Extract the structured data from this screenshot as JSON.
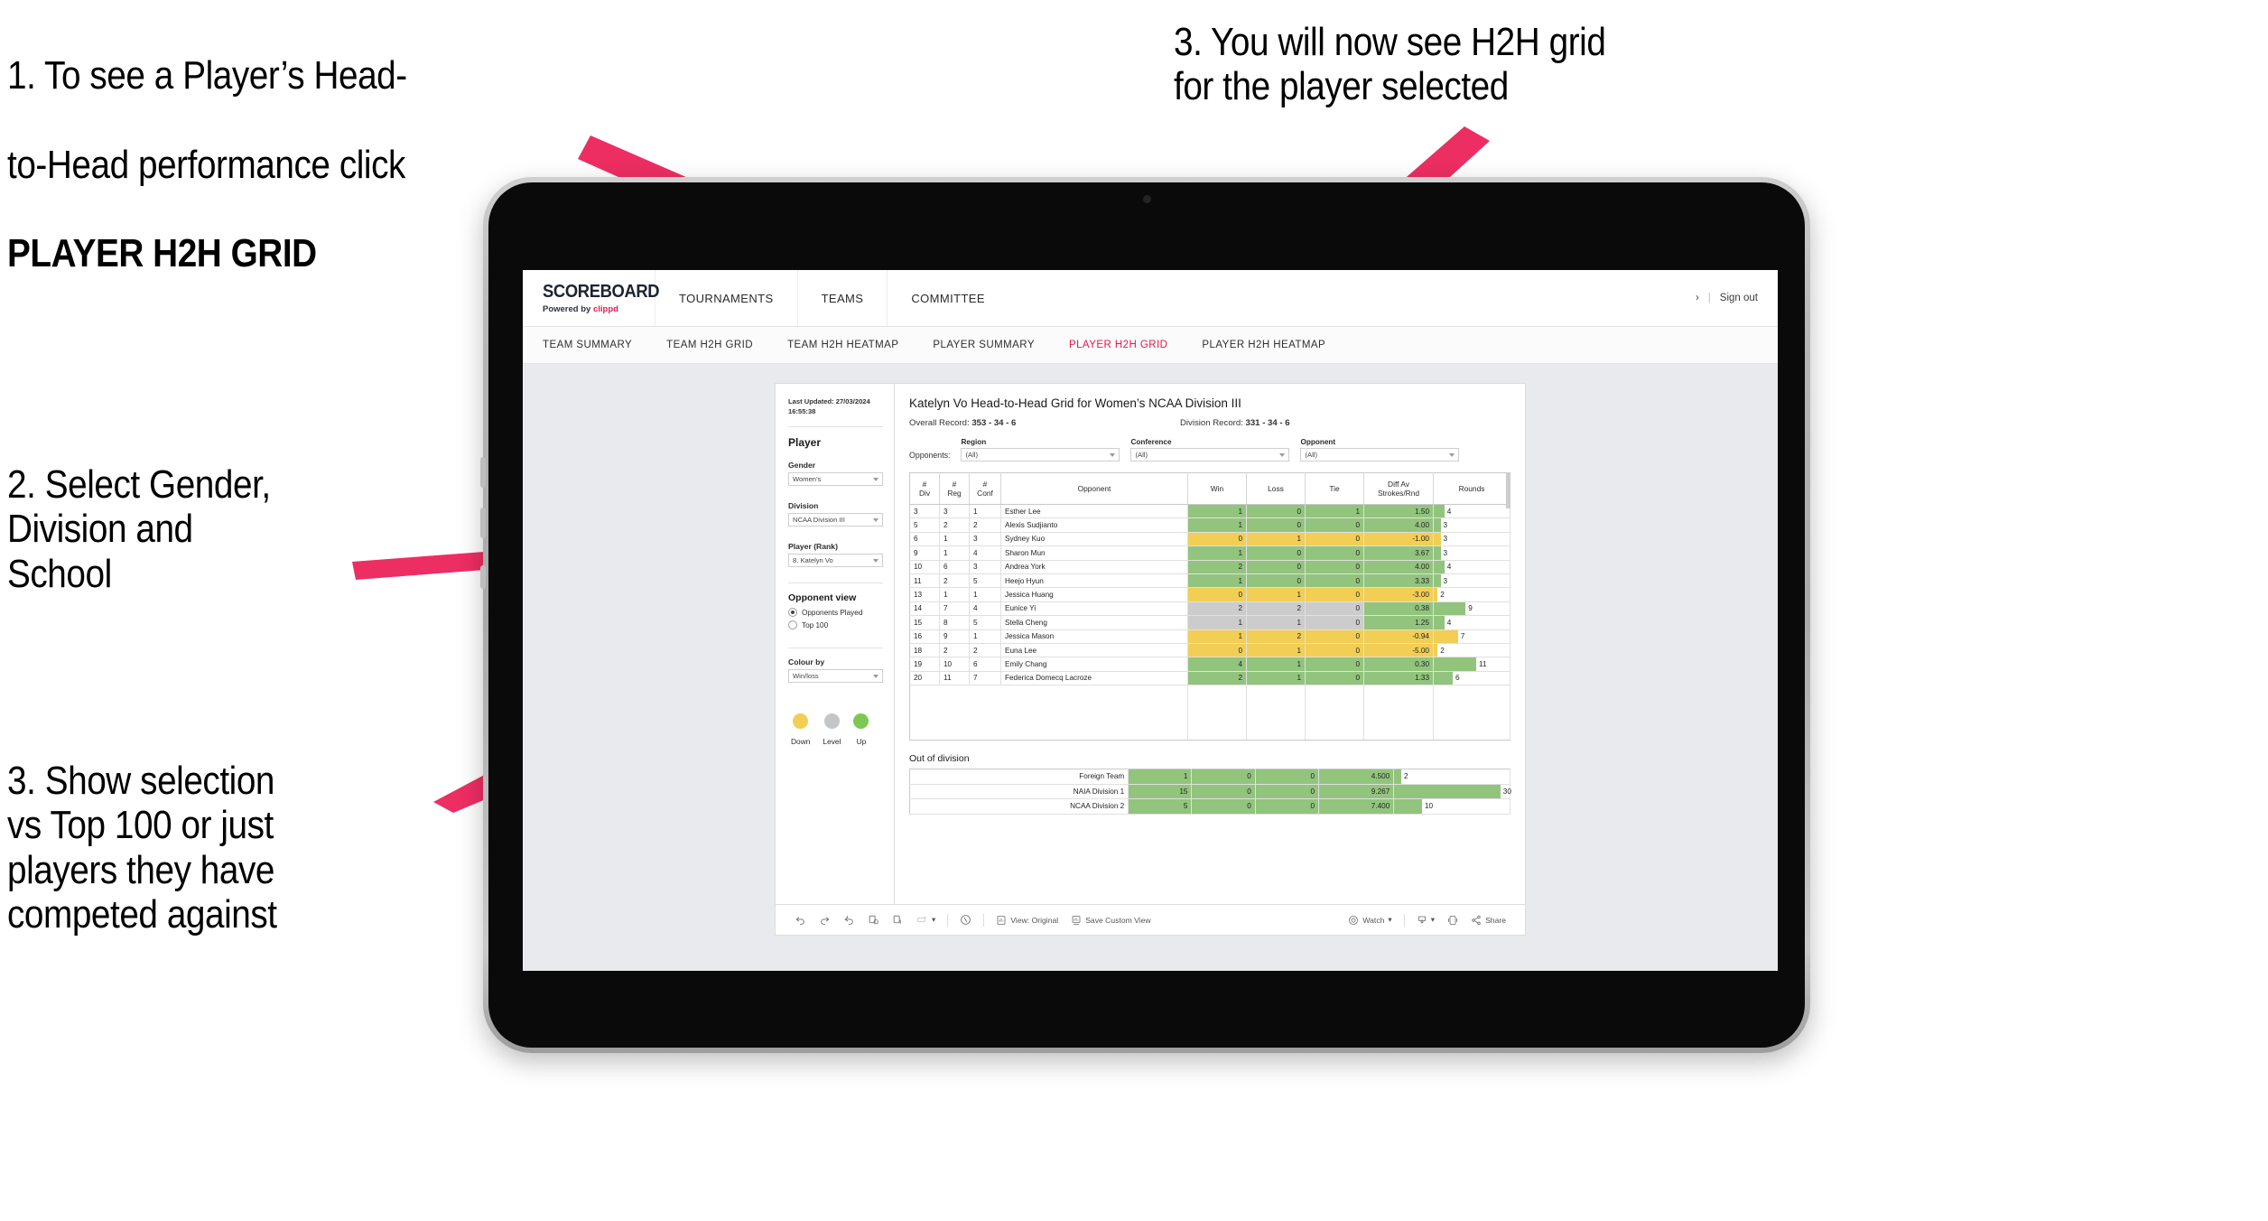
{
  "annotations": {
    "c1_line1": "1. To see a Player’s Head-",
    "c1_line2": "to-Head performance click",
    "c1_bold": "PLAYER H2H GRID",
    "c2": "2. Select Gender,\nDivision and\nSchool",
    "c3": "3. Show selection\nvs Top 100 or just\nplayers they have\ncompeted against",
    "c4": "3. You will now see H2H grid\nfor the player selected"
  },
  "colors": {
    "accent_pink": "#ED2E63",
    "brand_red": "#E8174C",
    "win_green": "#92C47D",
    "loss_yellow": "#F2CE55",
    "level_grey": "#CCCCCC",
    "canvas_grey": "#E8EAED"
  },
  "topbar": {
    "logo_word": "SCOREBOARD",
    "logo_sub_prefix": "Powered by ",
    "logo_sub_brand": "clippd",
    "items": [
      {
        "label": "TOURNAMENTS"
      },
      {
        "label": "TEAMS"
      },
      {
        "label": "COMMITTEE"
      }
    ],
    "chevron": "›",
    "separator": "|",
    "sign_out": "Sign out"
  },
  "subnav": {
    "items": [
      {
        "label": "TEAM SUMMARY",
        "active": false
      },
      {
        "label": "TEAM H2H GRID",
        "active": false
      },
      {
        "label": "TEAM H2H HEATMAP",
        "active": false
      },
      {
        "label": "PLAYER SUMMARY",
        "active": false
      },
      {
        "label": "PLAYER H2H GRID",
        "active": true
      },
      {
        "label": "PLAYER H2H HEATMAP",
        "active": false
      }
    ]
  },
  "controls": {
    "last_updated": "Last Updated: 27/03/2024\n16:55:38",
    "player_heading": "Player",
    "gender": {
      "label": "Gender",
      "value": "Women’s"
    },
    "division": {
      "label": "Division",
      "value": "NCAA Division III"
    },
    "player_rank": {
      "label": "Player (Rank)",
      "value": "8. Katelyn Vo"
    },
    "opponent_view": {
      "heading": "Opponent view",
      "options": [
        {
          "label": "Opponents Played",
          "selected": true
        },
        {
          "label": "Top 100",
          "selected": false
        }
      ]
    },
    "colour_by": {
      "label": "Colour by",
      "value": "Win/loss"
    },
    "legend": [
      {
        "label": "Down",
        "color": "#F2CE55"
      },
      {
        "label": "Level",
        "color": "#C3C6C9"
      },
      {
        "label": "Up",
        "color": "#7DC855"
      }
    ]
  },
  "main": {
    "title": "Katelyn Vo Head-to-Head Grid for Women’s NCAA Division III",
    "overall_record_label": "Overall Record: ",
    "overall_record_value": "353 -  34 - 6",
    "division_record_label": "Division Record: ",
    "division_record_value": "331 -  34 - 6",
    "opponents_label": "Opponents:",
    "filters": [
      {
        "label": "Region",
        "value": "(All)"
      },
      {
        "label": "Conference",
        "value": "(All)"
      },
      {
        "label": "Opponent",
        "value": "(All)"
      }
    ],
    "grid": {
      "headers": [
        {
          "l1": "#",
          "l2": "Div"
        },
        {
          "l1": "#",
          "l2": "Reg"
        },
        {
          "l1": "#",
          "l2": "Conf"
        },
        {
          "l1": "Opponent",
          "l2": ""
        },
        {
          "l1": "Win",
          "l2": ""
        },
        {
          "l1": "Loss",
          "l2": ""
        },
        {
          "l1": "Tie",
          "l2": ""
        },
        {
          "l1": "Diff Av",
          "l2": "Strokes/Rnd"
        },
        {
          "l1": "Rounds",
          "l2": ""
        }
      ],
      "rows": [
        {
          "div": "3",
          "reg": "3",
          "conf": "1",
          "opponent": "Esther Lee",
          "win": "1",
          "loss": "0",
          "tie": "1",
          "diff": "1.50",
          "rounds": "4",
          "color": "#92C47D",
          "rounds_pct": 14
        },
        {
          "div": "5",
          "reg": "2",
          "conf": "2",
          "opponent": "Alexis Sudjianto",
          "win": "1",
          "loss": "0",
          "tie": "0",
          "diff": "4.00",
          "rounds": "3",
          "color": "#92C47D",
          "rounds_pct": 9
        },
        {
          "div": "6",
          "reg": "1",
          "conf": "3",
          "opponent": "Sydney Kuo",
          "win": "0",
          "loss": "1",
          "tie": "0",
          "diff": "-1.00",
          "rounds": "3",
          "color": "#F2CE55",
          "rounds_pct": 9
        },
        {
          "div": "9",
          "reg": "1",
          "conf": "4",
          "opponent": "Sharon Mun",
          "win": "1",
          "loss": "0",
          "tie": "0",
          "diff": "3.67",
          "rounds": "3",
          "color": "#92C47D",
          "rounds_pct": 9
        },
        {
          "div": "10",
          "reg": "6",
          "conf": "3",
          "opponent": "Andrea York",
          "win": "2",
          "loss": "0",
          "tie": "0",
          "diff": "4.00",
          "rounds": "4",
          "color": "#92C47D",
          "rounds_pct": 14
        },
        {
          "div": "11",
          "reg": "2",
          "conf": "5",
          "opponent": "Heejo Hyun",
          "win": "1",
          "loss": "0",
          "tie": "0",
          "diff": "3.33",
          "rounds": "3",
          "color": "#92C47D",
          "rounds_pct": 9
        },
        {
          "div": "13",
          "reg": "1",
          "conf": "1",
          "opponent": "Jessica Huang",
          "win": "0",
          "loss": "1",
          "tie": "0",
          "diff": "-3.00",
          "rounds": "2",
          "color": "#F2CE55",
          "rounds_pct": 5
        },
        {
          "div": "14",
          "reg": "7",
          "conf": "4",
          "opponent": "Eunice Yi",
          "win": "2",
          "loss": "2",
          "tie": "0",
          "diff": "0.38",
          "rounds": "9",
          "color": "#CCCCCC",
          "diff_color": "#92C47D",
          "rounds_pct": 42
        },
        {
          "div": "15",
          "reg": "8",
          "conf": "5",
          "opponent": "Stella Cheng",
          "win": "1",
          "loss": "1",
          "tie": "0",
          "diff": "1.25",
          "rounds": "4",
          "color": "#CCCCCC",
          "diff_color": "#92C47D",
          "rounds_pct": 14
        },
        {
          "div": "16",
          "reg": "9",
          "conf": "1",
          "opponent": "Jessica Mason",
          "win": "1",
          "loss": "2",
          "tie": "0",
          "diff": "-0.94",
          "rounds": "7",
          "color": "#F2CE55",
          "rounds_pct": 32
        },
        {
          "div": "18",
          "reg": "2",
          "conf": "2",
          "opponent": "Euna Lee",
          "win": "0",
          "loss": "1",
          "tie": "0",
          "diff": "-5.00",
          "rounds": "2",
          "color": "#F2CE55",
          "rounds_pct": 5
        },
        {
          "div": "19",
          "reg": "10",
          "conf": "6",
          "opponent": "Emily Chang",
          "win": "4",
          "loss": "1",
          "tie": "0",
          "diff": "0.30",
          "rounds": "11",
          "color": "#92C47D",
          "rounds_pct": 56
        },
        {
          "div": "20",
          "reg": "11",
          "conf": "7",
          "opponent": "Federica Domecq Lacroze",
          "win": "2",
          "loss": "1",
          "tie": "0",
          "diff": "1.33",
          "rounds": "6",
          "color": "#92C47D",
          "rounds_pct": 25
        }
      ]
    },
    "out_of_division": {
      "title": "Out of division",
      "rows": [
        {
          "label": "Foreign Team",
          "win": "1",
          "loss": "0",
          "tie": "0",
          "diff": "4.500",
          "rounds": "2",
          "color": "#92C47D",
          "rounds_pct": 6
        },
        {
          "label": "NAIA Division 1",
          "win": "15",
          "loss": "0",
          "tie": "0",
          "diff": "9.267",
          "rounds": "30",
          "color": "#92C47D",
          "rounds_pct": 92
        },
        {
          "label": "NCAA Division 2",
          "win": "5",
          "loss": "0",
          "tie": "0",
          "diff": "7.400",
          "rounds": "10",
          "color": "#92C47D",
          "rounds_pct": 24
        }
      ]
    }
  },
  "toolbar": {
    "view_original": "View: Original",
    "save_custom_view": "Save Custom View",
    "watch": "Watch",
    "share": "Share",
    "caret": "▾"
  }
}
